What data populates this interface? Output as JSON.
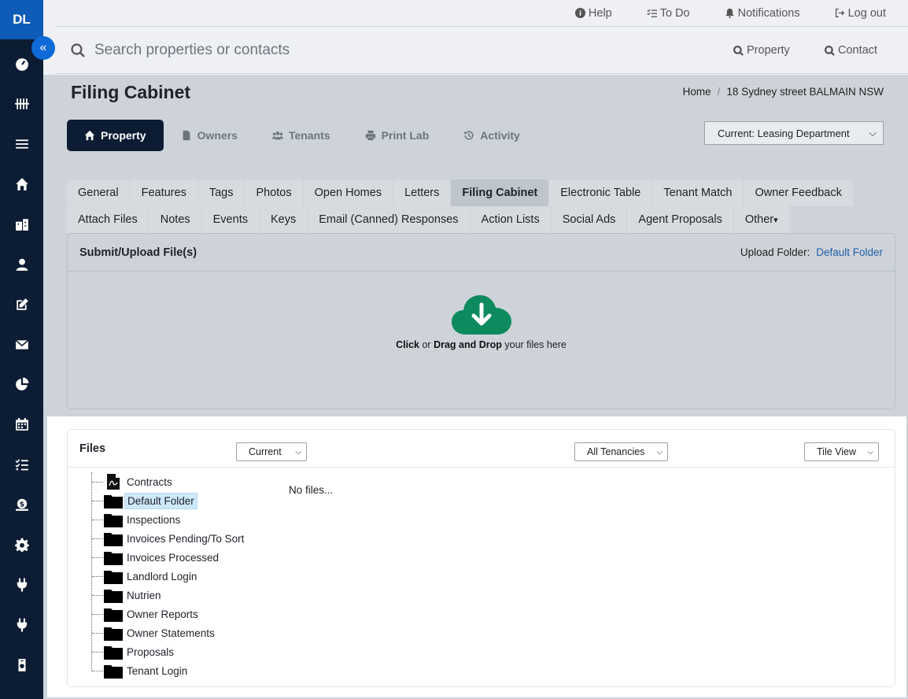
{
  "sidebar": {
    "initials": "DL",
    "collapse_glyph": "«",
    "items": [
      "gauge-icon",
      "tally-icon",
      "menu-icon",
      "home-icon",
      "building-icon",
      "user-icon",
      "edit-icon",
      "mail-icon",
      "pie-chart-icon",
      "calendar-icon",
      "tasks-icon",
      "money-icon",
      "settings-icon",
      "plug-icon",
      "plug-icon",
      "phone-icon"
    ]
  },
  "topbar": {
    "help": "Help",
    "todo": "To Do",
    "notifications": "Notifications",
    "logout": "Log out"
  },
  "search": {
    "placeholder": "Search properties or contacts",
    "property_label": "Property",
    "contact_label": "Contact"
  },
  "page": {
    "title": "Filing Cabinet",
    "breadcrumb": [
      "Home",
      "18 Sydney street BALMAIN NSW"
    ]
  },
  "mode_tabs": [
    "Property",
    "Owners",
    "Tenants",
    "Print Lab",
    "Activity"
  ],
  "department": {
    "selected": "Current: Leasing Department"
  },
  "subtabs": {
    "row1": [
      "General",
      "Features",
      "Tags",
      "Photos",
      "Open Homes",
      "Letters",
      "Filing Cabinet",
      "Electronic Table",
      "Tenant Match",
      "Owner Feedback"
    ],
    "row2": [
      "Attach Files",
      "Notes",
      "Events",
      "Keys",
      "Email (Canned) Responses",
      "Action Lists",
      "Social Ads",
      "Agent Proposals",
      "Other"
    ],
    "active": "Filing Cabinet"
  },
  "upload": {
    "title": "Submit/Upload File(s)",
    "folder_label": "Upload Folder:",
    "folder_value": "Default Folder",
    "click": "Click",
    "or": "or",
    "drag": "Drag and Drop",
    "rest": "your files here",
    "icon_color": "#0e8a5f"
  },
  "files": {
    "title": "Files",
    "status_select": "Current",
    "tenancy_select": "All Tenancies",
    "view_select": "Tile View",
    "empty_text": "No files...",
    "tree": [
      "Contracts",
      "Default Folder",
      "Inspections",
      "Invoices Pending/To Sort",
      "Invoices Processed",
      "Landlord Login",
      "Nutrien",
      "Owner Reports",
      "Owner Statements",
      "Proposals",
      "Tenant Login"
    ],
    "selected": "Default Folder"
  }
}
